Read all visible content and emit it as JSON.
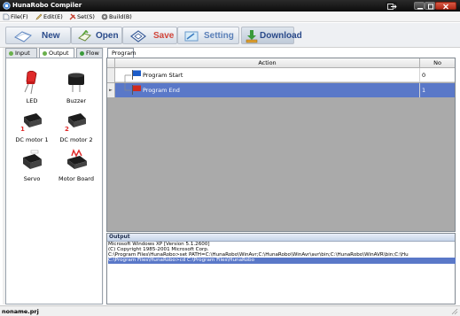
{
  "window": {
    "title": "HunaRobo Compiler",
    "icons": {
      "app": "robot-app-icon",
      "minimize": "minimize-icon",
      "maximize": "maximize-icon",
      "close": "close-icon"
    }
  },
  "menu": {
    "items": [
      {
        "label": "File(F)",
        "icon": "file-icon"
      },
      {
        "label": "Edit(E)",
        "icon": "edit-icon"
      },
      {
        "label": "Set(S)",
        "icon": "tools-icon"
      },
      {
        "label": "Build(B)",
        "icon": "build-icon"
      }
    ]
  },
  "toolbar": {
    "new_label": "New",
    "open_label": "Open",
    "save_label": "Save",
    "setting_label": "Setting",
    "download_label": "Download"
  },
  "palette": {
    "tabs": [
      {
        "label": "Input",
        "active": false
      },
      {
        "label": "Output",
        "active": true
      },
      {
        "label": "Flow",
        "active": false
      }
    ],
    "items": [
      {
        "label": "LED",
        "icon": "led-icon"
      },
      {
        "label": "Buzzer",
        "icon": "buzzer-icon"
      },
      {
        "label": "DC motor 1",
        "icon": "dc-motor-icon",
        "badge": "1"
      },
      {
        "label": "DC motor 2",
        "icon": "dc-motor-icon",
        "badge": "2"
      },
      {
        "label": "Servo",
        "icon": "servo-icon"
      },
      {
        "label": "Motor Board",
        "icon": "motor-board-icon"
      }
    ]
  },
  "program": {
    "tab_label": "Program",
    "columns": {
      "action": "Action",
      "no": "No"
    },
    "rows": [
      {
        "action": "Program Start",
        "no": "0",
        "flag_color": "#1c5cc8",
        "selected": false
      },
      {
        "action": "Program End",
        "no": "1",
        "flag_color": "#d02a1e",
        "selected": true
      }
    ]
  },
  "output": {
    "title": "Output",
    "lines": [
      {
        "text": "Microsoft Windows XP [Version 5.1.2600]",
        "selected": false
      },
      {
        "text": "(C) Copyright 1985-2001 Microsoft Corp.",
        "selected": false
      },
      {
        "text": "C:\\Program Files\\HunaRobo>set PATH=C:\\HunaRobo\\WinAvr;C:\\HunaRobo\\WinAvr\\avr\\bin;C:\\HunaRobo\\WinAVR\\bin;C:\\Hu",
        "selected": false
      },
      {
        "text": "C:\\Program Files\\HunaRobo>cd C:\\Program Files\\HunaRobo",
        "selected": true
      }
    ]
  },
  "status": {
    "text": "noname.prj"
  },
  "colors": {
    "selection": "#5a78c8",
    "title_bar": "#111111",
    "save_red": "#d1453a",
    "brand_blue": "#2a4a8a"
  }
}
